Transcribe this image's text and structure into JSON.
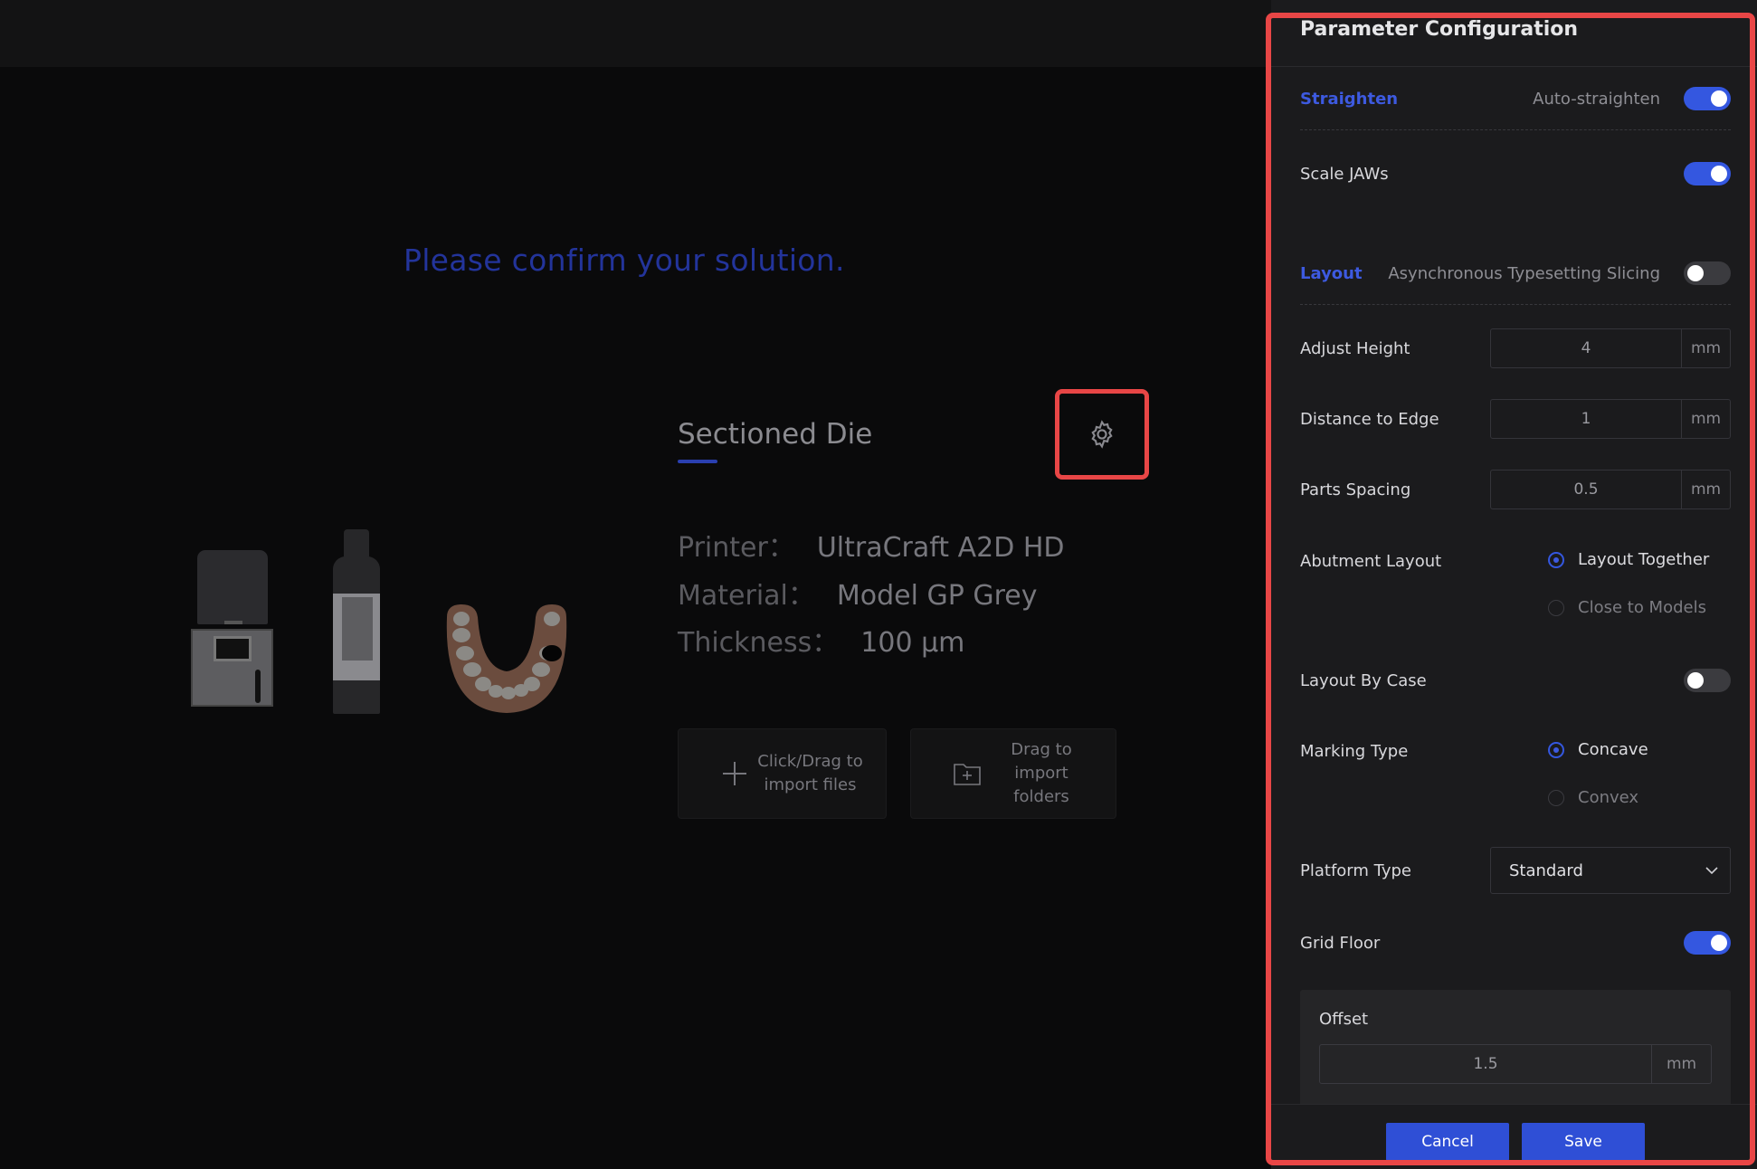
{
  "main": {
    "confirm_text": "Please confirm your solution.",
    "solution_title": "Sectioned Die",
    "info": [
      {
        "label": "Printer：",
        "value": "UltraCraft A2D HD"
      },
      {
        "label": "Material：",
        "value": "Model GP Grey"
      },
      {
        "label": "Thickness：",
        "value": "100 μm"
      }
    ],
    "import_files": "Click/Drag to import files",
    "import_folders": "Drag to import folders",
    "icons": [
      "gear-icon",
      "plus-icon",
      "folder-plus-icon"
    ]
  },
  "panel": {
    "title": "Parameter Configuration",
    "straighten": {
      "section": "Straighten",
      "label": "Auto-straighten",
      "on": true
    },
    "scale_jaws": {
      "label": "Scale JAWs",
      "on": true
    },
    "layout": {
      "section": "Layout",
      "label": "Asynchronous Typesetting Slicing",
      "on": false
    },
    "adjust_height": {
      "label": "Adjust Height",
      "value": "4",
      "unit": "mm"
    },
    "distance_to_edge": {
      "label": "Distance to Edge",
      "value": "1",
      "unit": "mm"
    },
    "parts_spacing": {
      "label": "Parts Spacing",
      "value": "0.5",
      "unit": "mm"
    },
    "abutment_layout": {
      "label": "Abutment Layout",
      "options": [
        "Layout Together",
        "Close to Models"
      ],
      "selected": "Layout Together"
    },
    "layout_by_case": {
      "label": "Layout By Case",
      "on": false
    },
    "marking_type": {
      "label": "Marking Type",
      "options": [
        "Concave",
        "Convex"
      ],
      "selected": "Concave"
    },
    "platform_type": {
      "label": "Platform Type",
      "value": "Standard"
    },
    "grid_floor": {
      "label": "Grid Floor",
      "on": true
    },
    "offset": {
      "label": "Offset",
      "value": "1.5",
      "unit": "mm"
    },
    "cancel_label": "Cancel",
    "save_label": "Save"
  },
  "colors": {
    "accent": "#3457e0",
    "highlight_border": "#e84646",
    "confirm_text": "#23349b"
  }
}
